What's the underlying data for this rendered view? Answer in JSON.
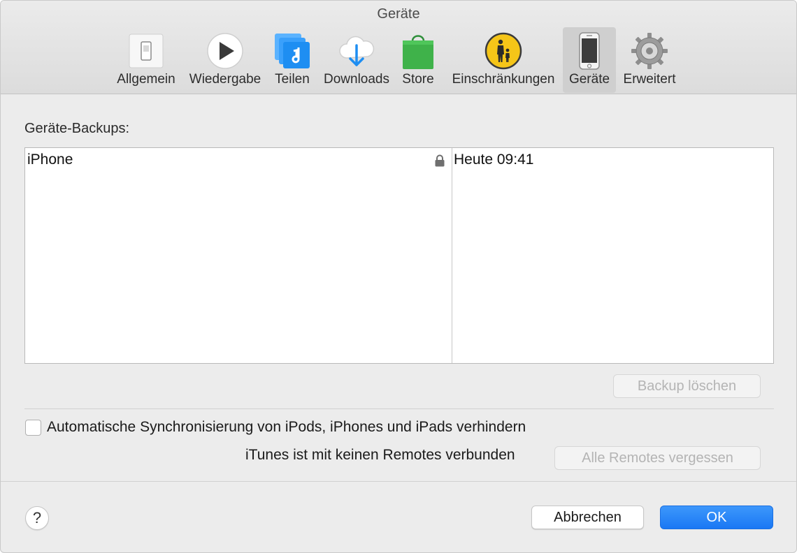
{
  "window": {
    "title": "Geräte"
  },
  "toolbar": {
    "tabs": [
      {
        "label": "Allgemein",
        "icon": "switch-icon"
      },
      {
        "label": "Wiedergabe",
        "icon": "play-icon"
      },
      {
        "label": "Teilen",
        "icon": "music-share-icon"
      },
      {
        "label": "Downloads",
        "icon": "cloud-download-icon"
      },
      {
        "label": "Store",
        "icon": "shopping-bag-icon"
      },
      {
        "label": "Einschränkungen",
        "icon": "parental-controls-icon"
      },
      {
        "label": "Geräte",
        "icon": "iphone-icon",
        "selected": true
      },
      {
        "label": "Erweitert",
        "icon": "gear-icon"
      }
    ]
  },
  "backups": {
    "section_label": "Geräte-Backups:",
    "rows": [
      {
        "device": "iPhone",
        "date": "Heute 09:41",
        "encrypted": true
      }
    ],
    "delete_button": "Backup löschen"
  },
  "sync": {
    "checkbox_label": "Automatische Synchronisierung von iPods, iPhones und iPads verhindern",
    "checked": false
  },
  "remotes": {
    "status_text": "iTunes ist mit keinen Remotes verbunden",
    "forget_button": "Alle Remotes vergessen"
  },
  "footer": {
    "help_label": "?",
    "cancel_button": "Abbrechen",
    "ok_button": "OK"
  },
  "colors": {
    "accent": "#1a78f4",
    "store_green": "#3fb24a",
    "parental_yellow": "#f5c518",
    "share_blue": "#1e8ef2"
  }
}
